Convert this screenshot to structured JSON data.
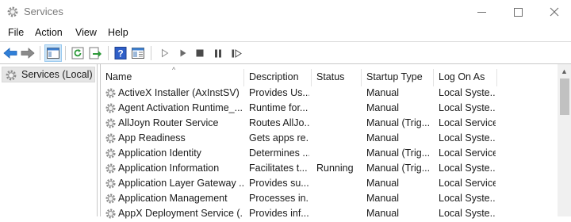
{
  "window": {
    "title": "Services"
  },
  "menu": [
    "File",
    "Action",
    "View",
    "Help"
  ],
  "tree": {
    "selected_label": "Services (Local)"
  },
  "columns": {
    "name": "Name",
    "description": "Description",
    "status": "Status",
    "startup": "Startup Type",
    "logon": "Log On As"
  },
  "rows": [
    {
      "name": "ActiveX Installer (AxInstSV)",
      "description": "Provides Us...",
      "status": "",
      "startup": "Manual",
      "logon": "Local Syste..."
    },
    {
      "name": "Agent Activation Runtime_...",
      "description": "Runtime for...",
      "status": "",
      "startup": "Manual",
      "logon": "Local Syste..."
    },
    {
      "name": "AllJoyn Router Service",
      "description": "Routes AllJo...",
      "status": "",
      "startup": "Manual (Trig...",
      "logon": "Local Service"
    },
    {
      "name": "App Readiness",
      "description": "Gets apps re...",
      "status": "",
      "startup": "Manual",
      "logon": "Local Syste..."
    },
    {
      "name": "Application Identity",
      "description": "Determines ...",
      "status": "",
      "startup": "Manual (Trig...",
      "logon": "Local Service"
    },
    {
      "name": "Application Information",
      "description": "Facilitates t...",
      "status": "Running",
      "startup": "Manual (Trig...",
      "logon": "Local Syste..."
    },
    {
      "name": "Application Layer Gateway ...",
      "description": "Provides su...",
      "status": "",
      "startup": "Manual",
      "logon": "Local Service"
    },
    {
      "name": "Application Management",
      "description": "Processes in...",
      "status": "",
      "startup": "Manual",
      "logon": "Local Syste..."
    },
    {
      "name": "AppX Deployment Service (...",
      "description": "Provides inf...",
      "status": "",
      "startup": "Manual",
      "logon": "Local Syste..."
    }
  ],
  "icons": {
    "app": "gear-icon",
    "toolbar": [
      "back-arrow-icon",
      "forward-arrow-icon",
      "console-tree-icon",
      "refresh-icon",
      "export-list-icon",
      "help-icon",
      "properties-icon",
      "start-icon",
      "start-paused-icon",
      "stop-icon",
      "pause-icon",
      "resume-icon"
    ],
    "row": "gear-icon"
  },
  "colors": {
    "accent_blue": "#1e6fd9",
    "selection": "#cce4f7"
  }
}
